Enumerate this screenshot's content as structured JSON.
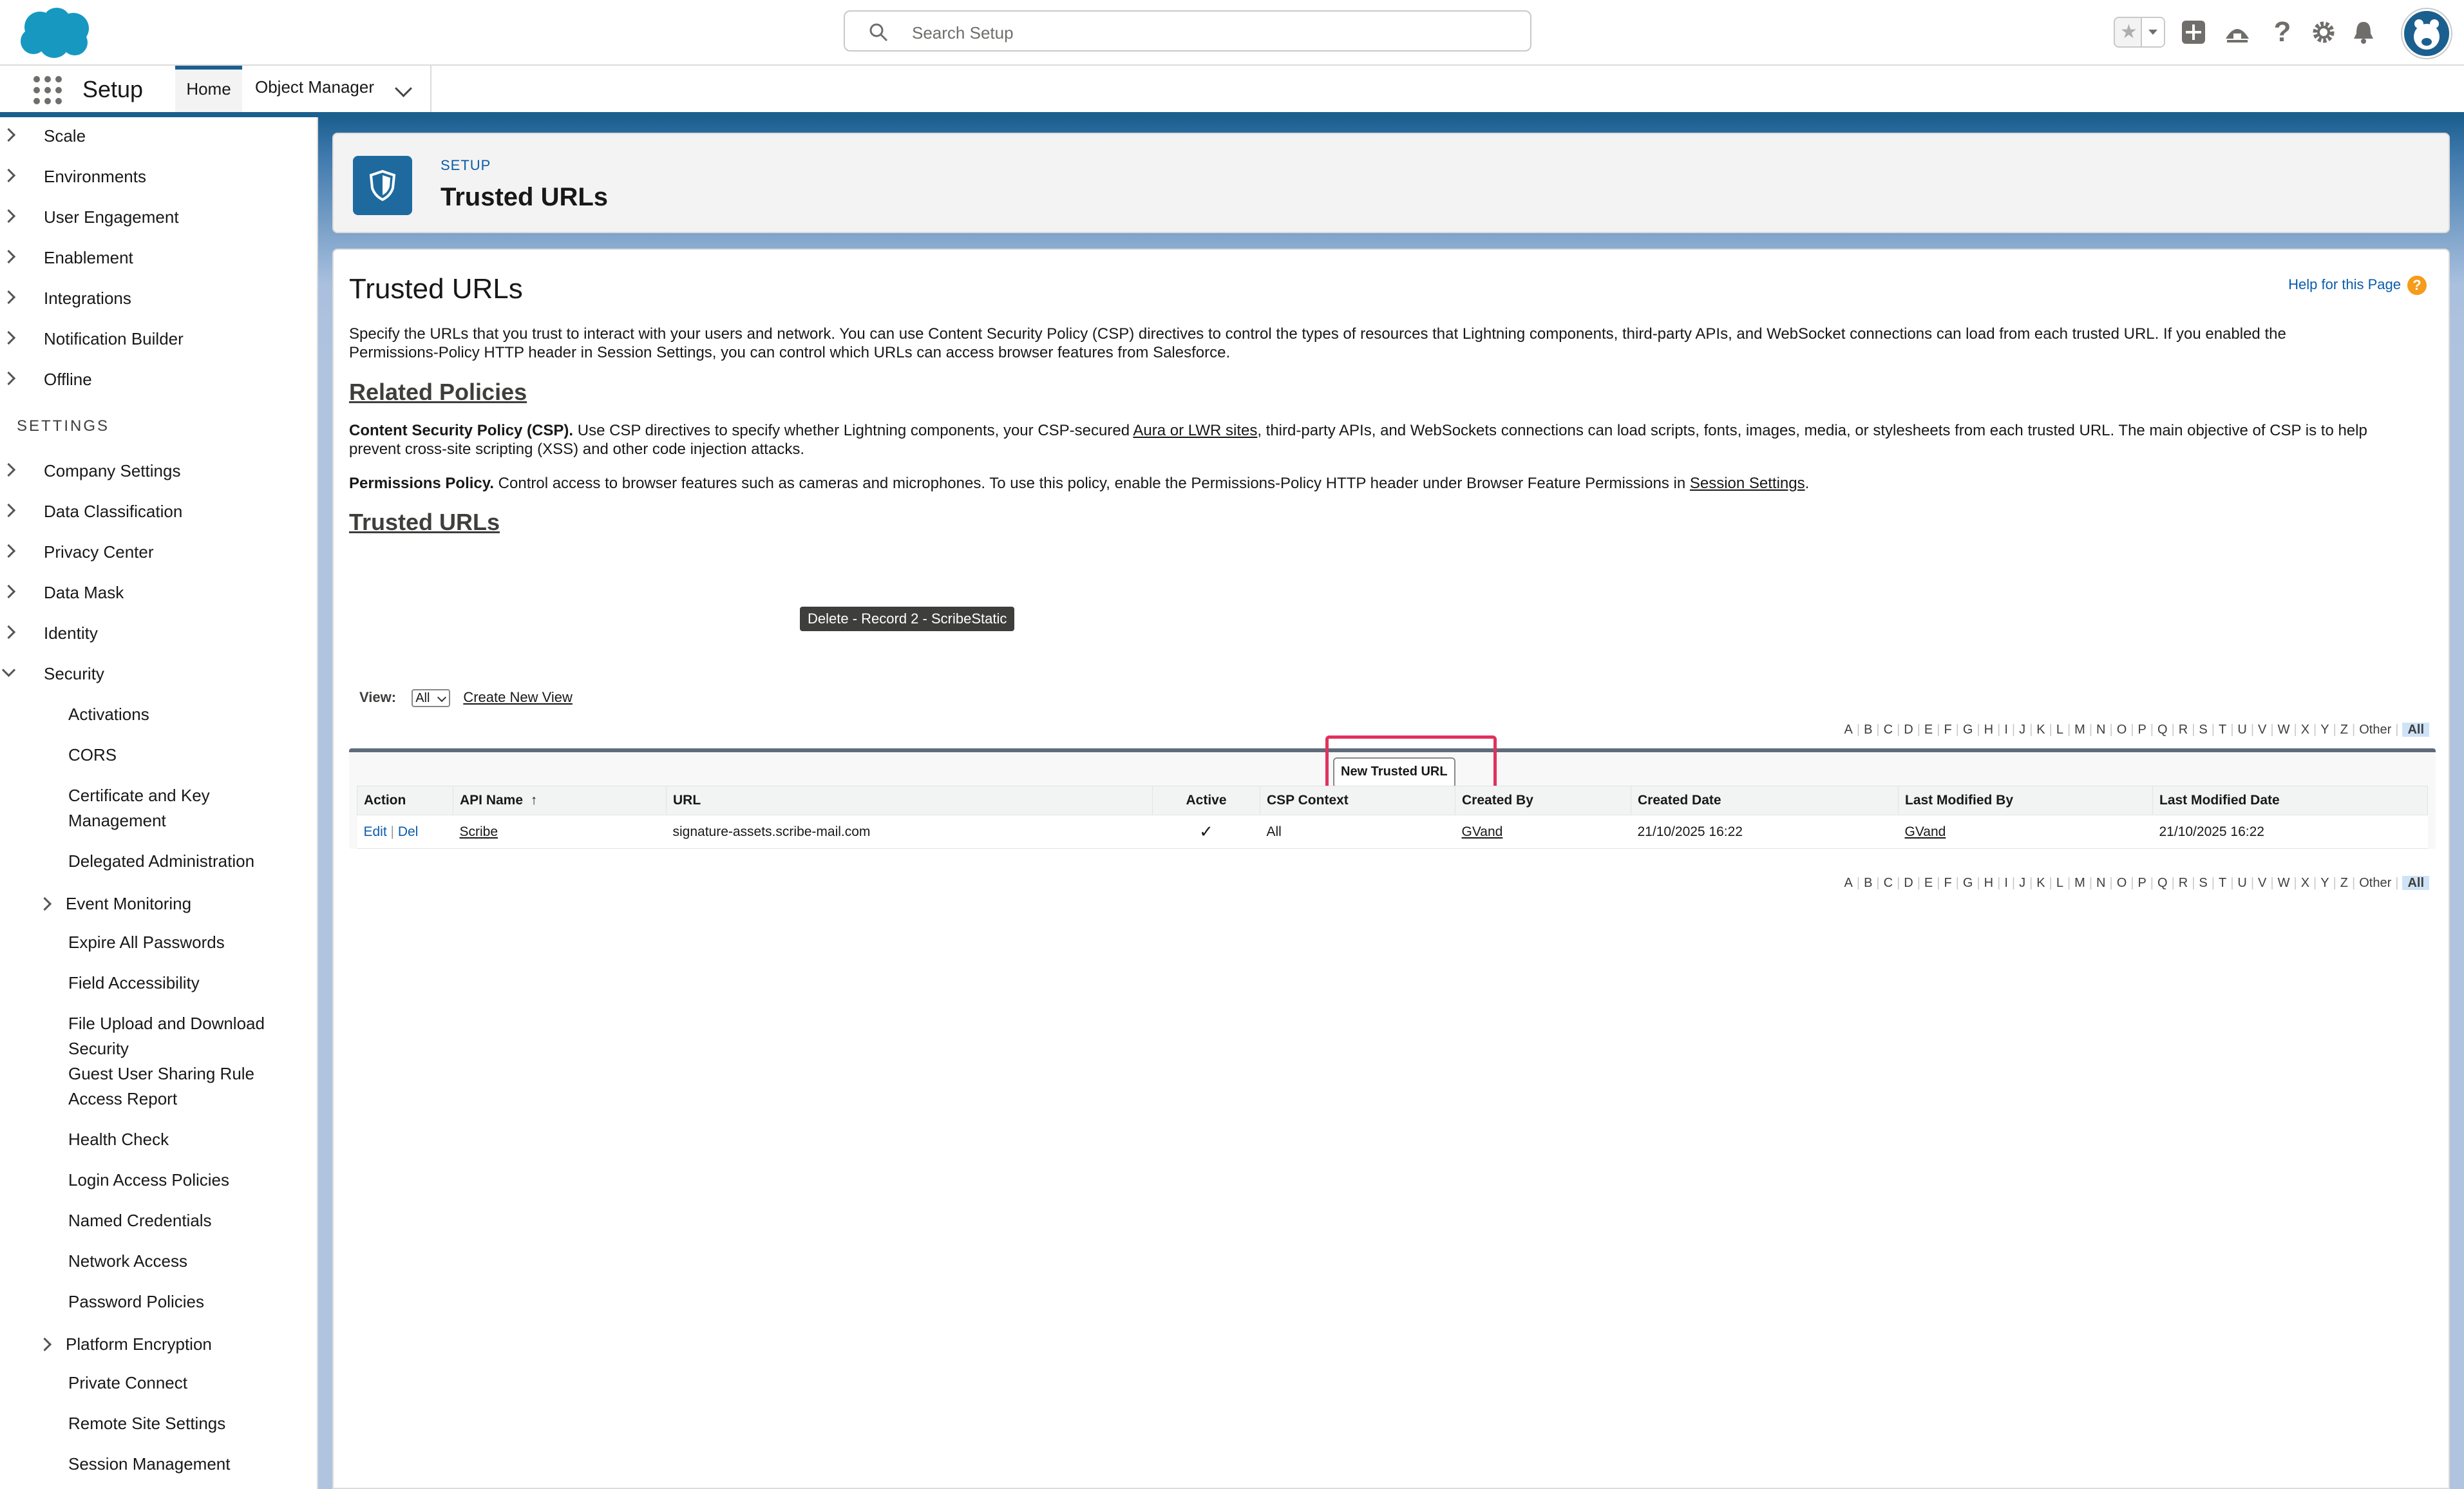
{
  "header": {
    "search_placeholder": "Search Setup",
    "icons": [
      "favorites-icon",
      "add-icon",
      "trailhead-icon",
      "help-icon",
      "setup-gear-icon",
      "notification-bell-icon",
      "avatar"
    ]
  },
  "context_bar": {
    "app_name": "Setup",
    "tabs": [
      {
        "label": "Home"
      },
      {
        "label": "Object Manager"
      }
    ]
  },
  "sidebar": {
    "top_items": [
      "Scale",
      "Environments",
      "User Engagement",
      "Enablement",
      "Integrations",
      "Notification Builder",
      "Offline"
    ],
    "settings_label": "SETTINGS",
    "settings_items": [
      "Company Settings",
      "Data Classification",
      "Privacy Center",
      "Data Mask",
      "Identity",
      "Security"
    ],
    "security_children": [
      "Activations",
      "CORS",
      "Certificate and Key Management",
      "Delegated Administration",
      "Event Monitoring",
      "Expire All Passwords",
      "Field Accessibility",
      "File Upload and Download Security",
      "Guest User Sharing Rule Access Report",
      "Health Check",
      "Login Access Policies",
      "Named Credentials",
      "Network Access",
      "Password Policies",
      "Platform Encryption",
      "Private Connect",
      "Remote Site Settings",
      "Session Management"
    ]
  },
  "page_header": {
    "eyebrow": "SETUP",
    "title": "Trusted URLs"
  },
  "content": {
    "title": "Trusted URLs",
    "help_link": "Help for this Page",
    "intro_1": "Specify the URLs that you trust to interact with your users and network. You can use Content Security Policy (CSP) directives to control the types of resources that Lightning components, third-party APIs, and WebSocket connections can load from each trusted URL. If you enabled the",
    "intro_2": "Permissions-Policy HTTP header in Session Settings, you can control which URLs can access browser features from Salesforce.",
    "related_heading": "Related Policies",
    "csp_label": "Content Security Policy (CSP).",
    "csp_text_a": " Use CSP directives to specify whether Lightning components, your CSP-secured ",
    "csp_link": "Aura or LWR sites",
    "csp_text_b": ", third-party APIs, and WebSockets connections can load scripts, fonts, images, media, or stylesheets from each trusted URL. The main objective of CSP is to help",
    "csp_text_c": "prevent cross-site scripting (XSS) and other code injection attacks.",
    "perm_label": "Permissions Policy.",
    "perm_text": " Control access to browser features such as cameras and microphones. To use this policy, enable the Permissions-Policy HTTP header under Browser Feature Permissions in ",
    "perm_link": "Session Settings",
    "perm_end": ".",
    "trusted_heading": "Trusted URLs",
    "tooltip": "Delete - Record 2 - ScribeStatic",
    "view_label": "View:",
    "view_value": "All",
    "create_view": "Create New View",
    "alphabet": [
      "A",
      "B",
      "C",
      "D",
      "E",
      "F",
      "G",
      "H",
      "I",
      "J",
      "K",
      "L",
      "M",
      "N",
      "O",
      "P",
      "Q",
      "R",
      "S",
      "T",
      "U",
      "V",
      "W",
      "X",
      "Y",
      "Z",
      "Other",
      "All"
    ],
    "new_button": "New Trusted URL"
  },
  "table": {
    "columns": [
      "Action",
      "API Name",
      "URL",
      "Active",
      "CSP Context",
      "Created By",
      "Created Date",
      "Last Modified By",
      "Last Modified Date"
    ],
    "sort_indicator": "↑",
    "rows": [
      {
        "edit": "Edit",
        "sep": " | ",
        "del": "Del",
        "api_name": "Scribe",
        "url": "signature-assets.scribe-mail.com",
        "active": "✓",
        "csp_context": "All",
        "created_by": "GVand",
        "created_date": "21/10/2025 16:22",
        "last_modified_by": "GVand",
        "last_modified_date": "21/10/2025 16:22"
      }
    ]
  },
  "colors": {
    "brand": "#1b5f8f",
    "link": "#0b5cab",
    "highlight": "#e0325f"
  }
}
